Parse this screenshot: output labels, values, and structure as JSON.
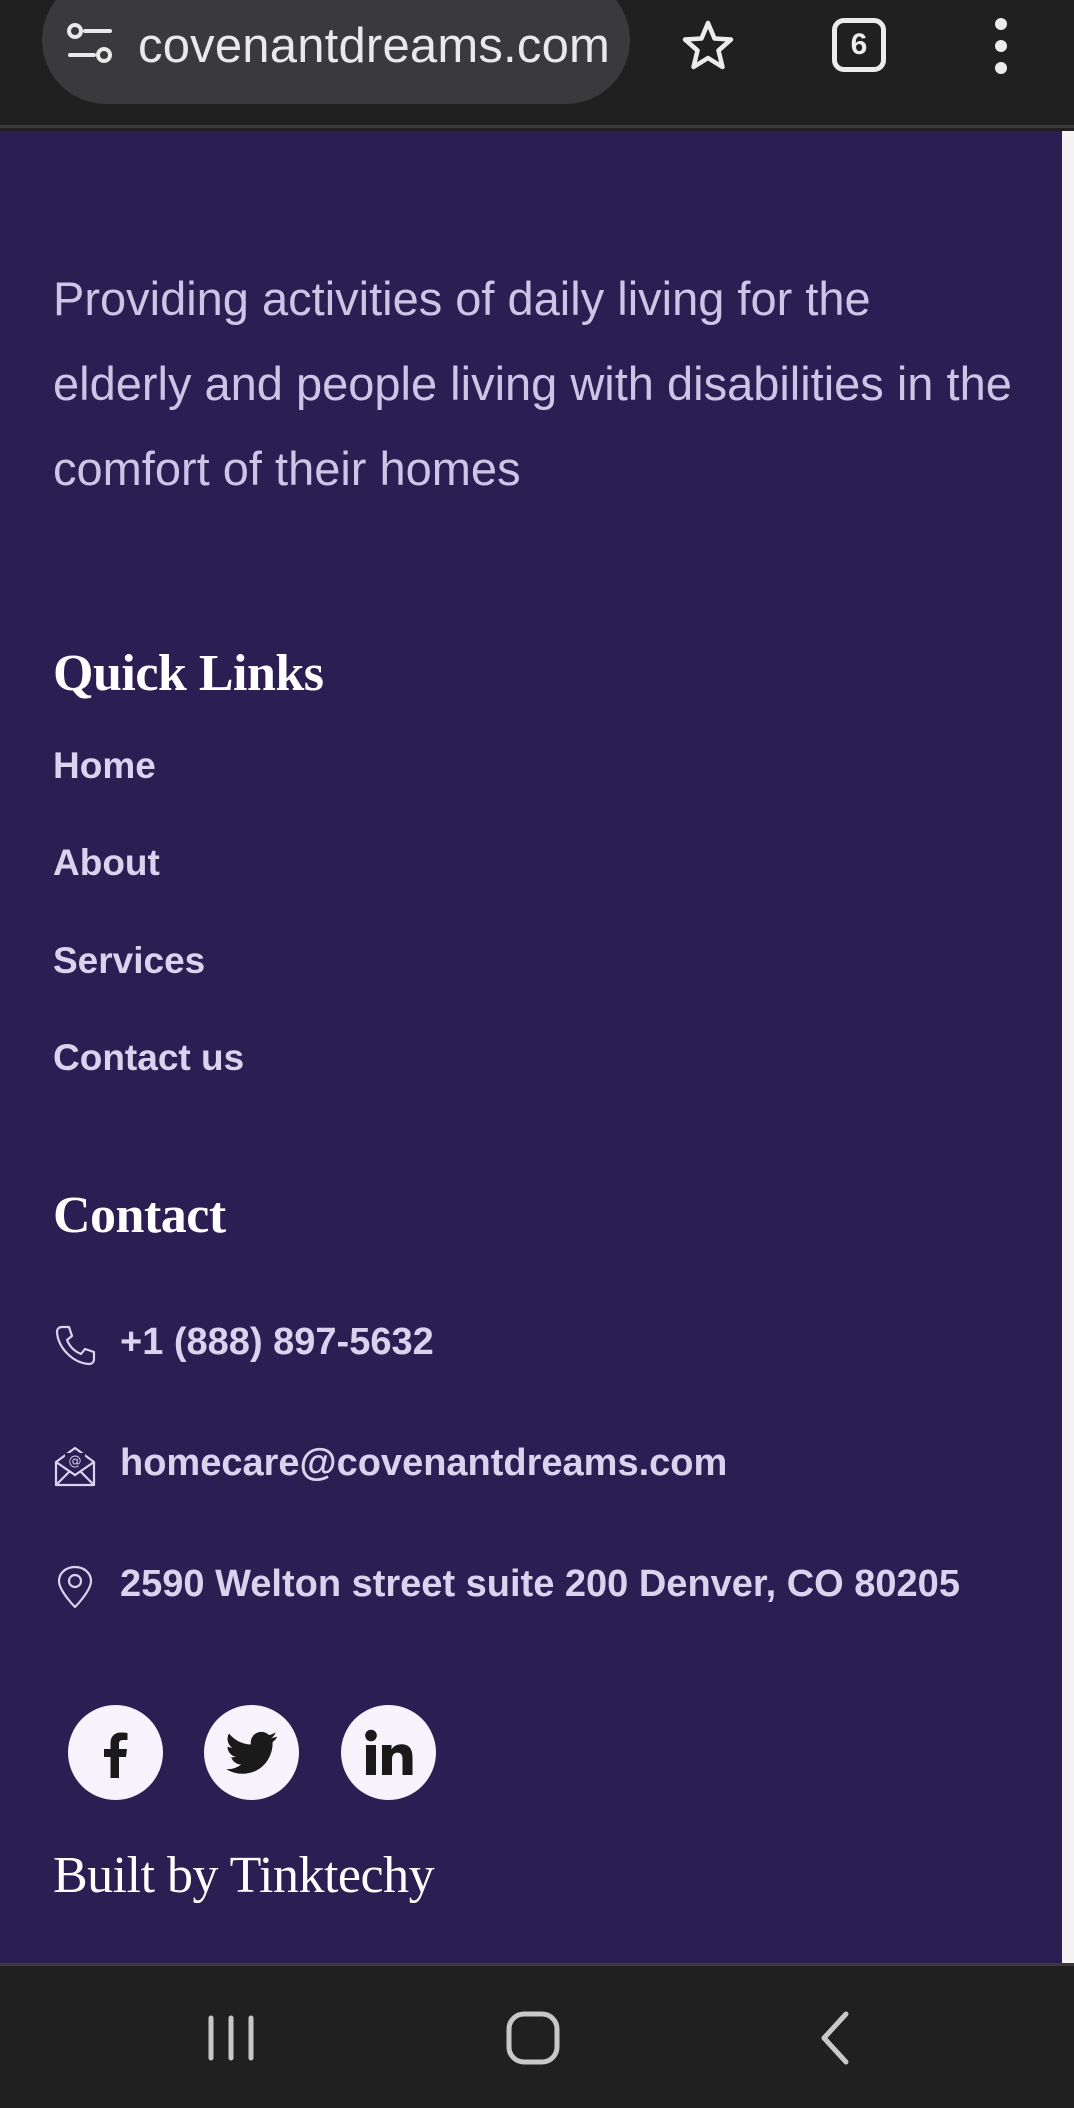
{
  "browser": {
    "url": "covenantdreams.com",
    "tab_count": "6",
    "icons": [
      "site-info-icon",
      "bookmark-star-icon",
      "overflow-menu-icon"
    ]
  },
  "footer": {
    "tagline": "Providing activities of daily living for the elderly and people living with disabilities in the comfort of their homes",
    "quick_links": {
      "title": "Quick Links",
      "items": [
        "Home",
        "About",
        "Services",
        "Contact us"
      ]
    },
    "contact": {
      "title": "Contact",
      "phone": "+1 (888) 897-5632",
      "email": "homecare@covenantdreams.com",
      "address": "2590 Welton street suite 200 Denver, CO 80205"
    },
    "social": [
      "facebook-icon",
      "twitter-icon",
      "linkedin-icon"
    ],
    "credit": "Built by Tinktechy"
  },
  "colors": {
    "page_bg": "#2b1e53",
    "text": "#d9d3ee",
    "heading": "#ffffff",
    "chrome_bg": "#202020"
  },
  "system_nav": [
    "recent-apps-icon",
    "home-icon",
    "back-icon"
  ]
}
